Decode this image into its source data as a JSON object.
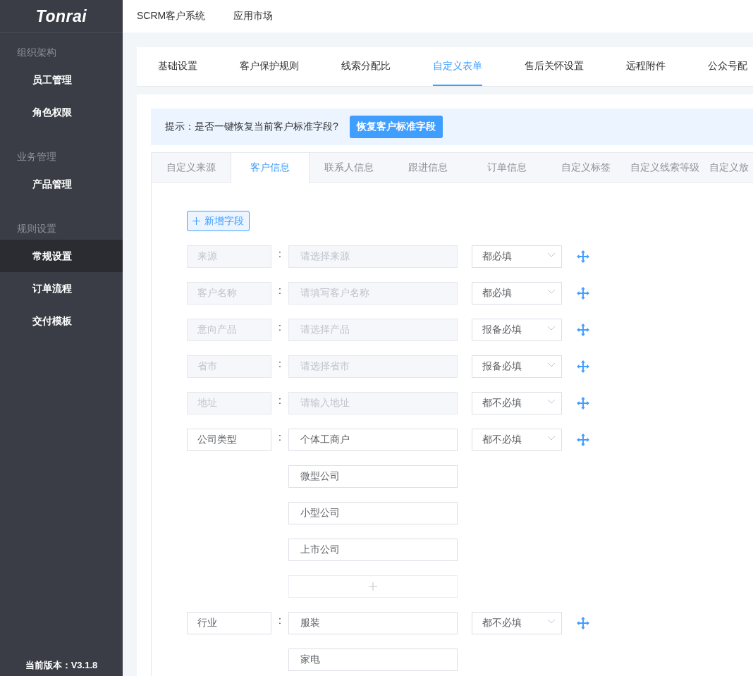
{
  "sidebar": {
    "logo": "Tonrai",
    "groups": [
      {
        "heading": "组织架构",
        "items": [
          {
            "label": "员工管理",
            "selected": false
          },
          {
            "label": "角色权限",
            "selected": false
          }
        ]
      },
      {
        "heading": "业务管理",
        "items": [
          {
            "label": "产品管理",
            "selected": false
          }
        ]
      },
      {
        "heading": "规则设置",
        "items": [
          {
            "label": "常规设置",
            "selected": true
          },
          {
            "label": "订单流程",
            "selected": false
          },
          {
            "label": "交付模板",
            "selected": false
          }
        ]
      }
    ],
    "version": "当前版本：V3.1.8"
  },
  "top_nav": [
    "SCRM客户系统",
    "应用市场"
  ],
  "settings_tabs": [
    {
      "label": "基础设置",
      "selected": false
    },
    {
      "label": "客户保护规则",
      "selected": false
    },
    {
      "label": "线索分配比",
      "selected": false
    },
    {
      "label": "自定义表单",
      "selected": true
    },
    {
      "label": "售后关怀设置",
      "selected": false
    },
    {
      "label": "远程附件",
      "selected": false
    },
    {
      "label": "公众号配",
      "selected": false
    }
  ],
  "tip": {
    "text": "提示：是否一键恢复当前客户标准字段?",
    "button": "恢复客户标准字段"
  },
  "form_tabs": [
    {
      "label": "自定义来源",
      "selected": false
    },
    {
      "label": "客户信息",
      "selected": true
    },
    {
      "label": "联系人信息",
      "selected": false
    },
    {
      "label": "跟进信息",
      "selected": false
    },
    {
      "label": "订单信息",
      "selected": false
    },
    {
      "label": "自定义标签",
      "selected": false
    },
    {
      "label": "自定义线索等级",
      "selected": false
    },
    {
      "label": "自定义放",
      "selected": false
    }
  ],
  "add_field_button": "新增字段",
  "fields": [
    {
      "kind": "input",
      "label": "来源",
      "separator": ":",
      "disabled": true,
      "placeholder": "请选择来源",
      "requirement": "都必填"
    },
    {
      "kind": "input",
      "label": "客户名称",
      "separator": ":",
      "disabled": true,
      "placeholder": "请填写客户名称",
      "requirement": "都必填"
    },
    {
      "kind": "input",
      "label": "意向产品",
      "separator": ":",
      "disabled": true,
      "placeholder": "请选择产品",
      "requirement": "报备必填"
    },
    {
      "kind": "input",
      "label": "省市",
      "separator": ":",
      "disabled": true,
      "placeholder": "请选择省市",
      "requirement": "报备必填"
    },
    {
      "kind": "input",
      "label": "地址",
      "separator": ":",
      "disabled": true,
      "placeholder": "请输入地址",
      "requirement": "都不必填"
    },
    {
      "kind": "options",
      "label": "公司类型",
      "separator": ":",
      "disabled": false,
      "options": [
        "个体工商户",
        "微型公司",
        "小型公司",
        "上市公司"
      ],
      "add_option": true,
      "requirement": "都不必填"
    },
    {
      "kind": "options",
      "label": "行业",
      "separator": ":",
      "disabled": false,
      "options": [
        "服装",
        "家电"
      ],
      "requirement": "都不必填"
    }
  ]
}
